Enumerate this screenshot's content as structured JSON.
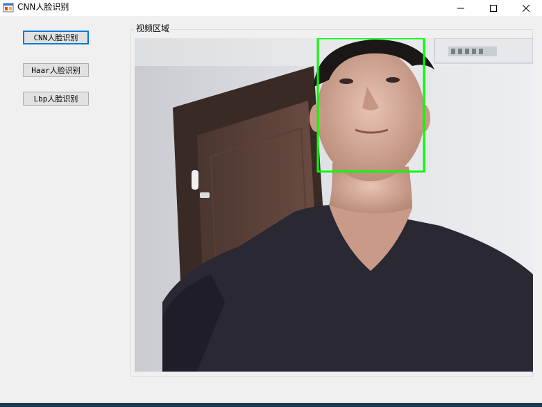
{
  "window": {
    "title": "CNN人脸识别",
    "app_icon": "winforms-app-icon",
    "controls": {
      "minimize_icon": "minimize-icon",
      "maximize_icon": "maximize-icon",
      "close_icon": "close-icon"
    }
  },
  "sidebar": {
    "buttons": [
      {
        "label": "CNN人脸识别",
        "focused": true
      },
      {
        "label": "Haar人脸识别",
        "focused": false
      },
      {
        "label": "Lbp人脸识别",
        "focused": false
      }
    ]
  },
  "video_area": {
    "label": "视频区域",
    "detection_box_color": "#00ff00",
    "faces_detected": 1
  },
  "colors": {
    "titlebar": "#ffffff",
    "client": "#f0f0f0",
    "button_face": "#e1e1e1",
    "focus_border": "#0078d7"
  }
}
